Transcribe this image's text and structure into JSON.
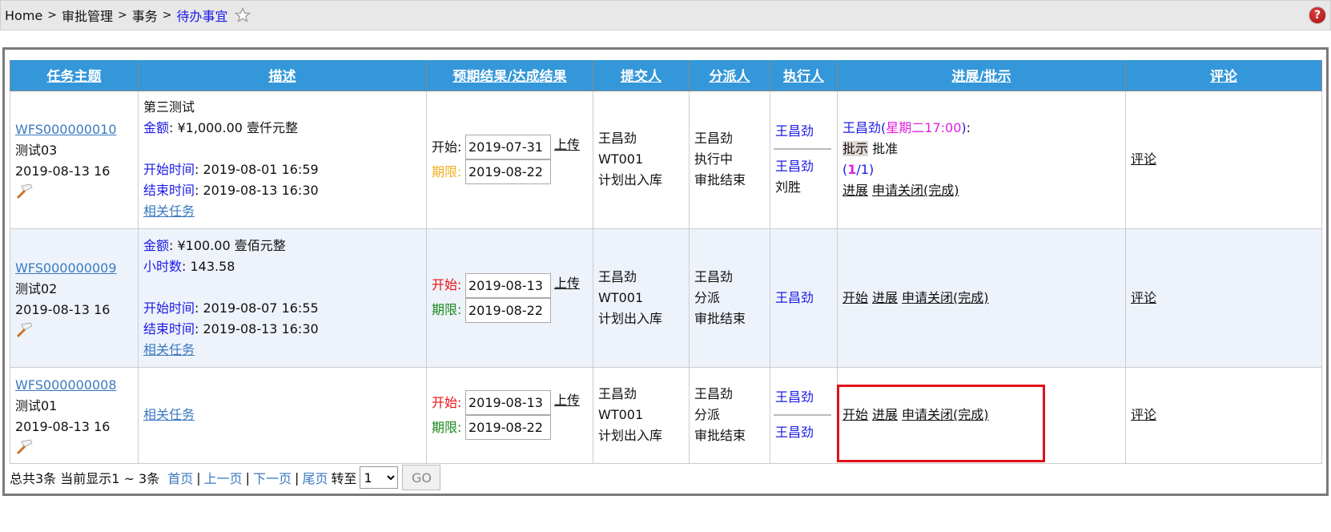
{
  "breadcrumb": {
    "items": [
      "Home",
      "审批管理",
      "事务",
      "待办事宜"
    ],
    "separator": ">"
  },
  "icons": {
    "favorite": "star-outline-icon",
    "help": "help-icon",
    "help_glyph": "?"
  },
  "table": {
    "headers": [
      "任务主题",
      "描述",
      "预期结果/达成结果",
      "提交人",
      "分派人",
      "执行人",
      "进展/批示",
      "评论"
    ],
    "rows": [
      {
        "task_id": "WFS000000010",
        "task_name": "测试03",
        "task_time": "2019-08-13 16",
        "desc_title": "第三测试",
        "amount_label": "金额",
        "amount_value": ": ¥1,000.00 壹仟元整",
        "hours_label": "",
        "hours_value": "",
        "start_label": "开始时间",
        "start_value": ": 2019-08-01 16:59",
        "end_label": "结束时间",
        "end_value": ": 2019-08-13 16:30",
        "related": "相关任务",
        "date_start_label": "开始:",
        "date_start_value": "2019-07-31",
        "date_limit_label": "期限:",
        "date_limit_value": "2019-08-22",
        "upload": "上传",
        "submitter": [
          "王昌劲",
          "WT001",
          "计划出入库"
        ],
        "assigner": [
          "王昌劲",
          "执行中",
          "审批结束"
        ],
        "executor_top": "王昌劲",
        "executor_bottom": [
          "王昌劲",
          "刘胜"
        ],
        "progress_name": "王昌劲",
        "progress_time": "星期二17:00",
        "progress_tag": "批示",
        "progress_text": "批准",
        "progress_count_current": "1",
        "progress_count_total": "1",
        "actions": [
          "进展",
          "申请关闭(完成)"
        ],
        "comment": "评论"
      },
      {
        "task_id": "WFS000000009",
        "task_name": "测试02",
        "task_time": "2019-08-13 16",
        "amount_label": "金额",
        "amount_value": ": ¥100.00 壹佰元整",
        "hours_label": "小时数",
        "hours_value": ": 143.58",
        "start_label": "开始时间",
        "start_value": ": 2019-08-07 16:55",
        "end_label": "结束时间",
        "end_value": ": 2019-08-13 16:30",
        "related": "相关任务",
        "date_start_label": "开始:",
        "date_start_value": "2019-08-13",
        "date_limit_label": "期限:",
        "date_limit_value": "2019-08-22",
        "upload": "上传",
        "submitter": [
          "王昌劲",
          "WT001",
          "计划出入库"
        ],
        "assigner": [
          "王昌劲",
          "分派",
          "审批结束"
        ],
        "executor": "王昌劲",
        "actions": [
          "开始",
          "进展",
          "申请关闭(完成)"
        ],
        "comment": "评论"
      },
      {
        "task_id": "WFS000000008",
        "task_name": "测试01",
        "task_time": "2019-08-13 16",
        "related": "相关任务",
        "date_start_label": "开始:",
        "date_start_value": "2019-08-13",
        "date_limit_label": "期限:",
        "date_limit_value": "2019-08-22",
        "upload": "上传",
        "submitter": [
          "王昌劲",
          "WT001",
          "计划出入库"
        ],
        "assigner": [
          "王昌劲",
          "分派",
          "审批结束"
        ],
        "executor_top": "王昌劲",
        "executor_bottom": [
          "王昌劲"
        ],
        "actions": [
          "开始",
          "进展",
          "申请关闭(完成)"
        ],
        "comment": "评论"
      }
    ]
  },
  "pager": {
    "summary": "总共3条 当前显示1 ~ 3条",
    "first": "首页",
    "prev": "上一页",
    "next": "下一页",
    "last": "尾页",
    "divider": "|",
    "goto_label": "转至",
    "page_selected": "1",
    "go": "GO"
  },
  "colors": {
    "header_bg": "#3497d9",
    "alt_row_bg": "#eef3fb",
    "link": "#3a7abf",
    "label": "#1a1ae6",
    "highlight_box": "#e0101a",
    "magenta": "#e020e0"
  }
}
